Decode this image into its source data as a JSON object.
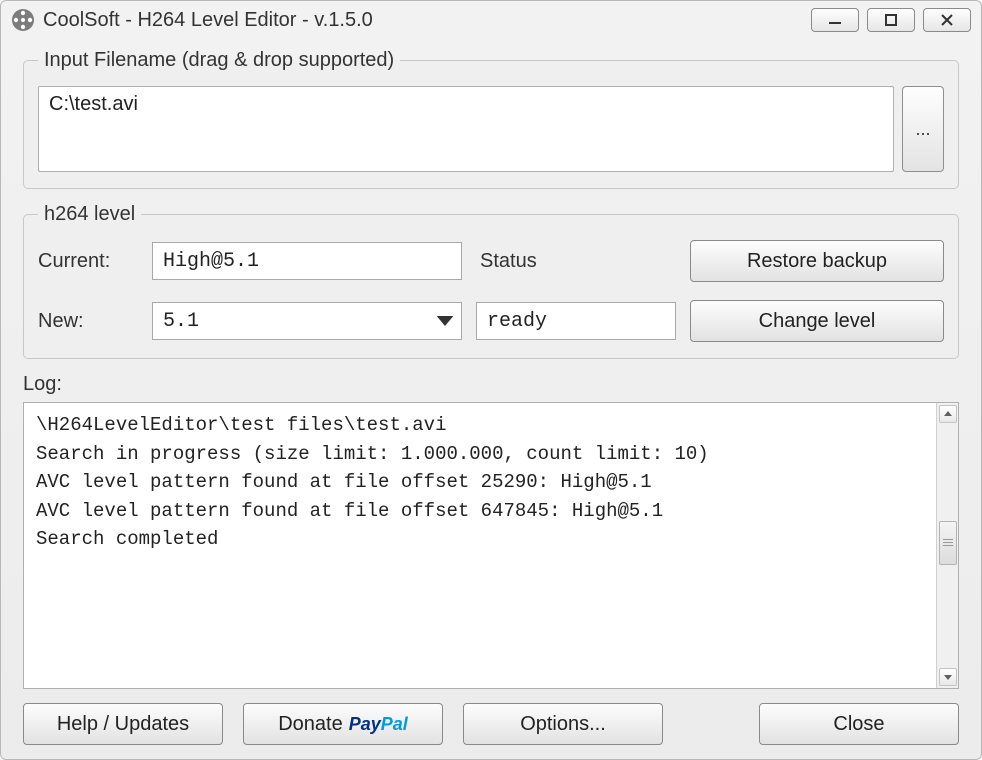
{
  "window": {
    "title": "CoolSoft - H264 Level Editor - v.1.5.0"
  },
  "input_group": {
    "legend": "Input Filename (drag & drop supported)",
    "filename": "C:\\test.avi",
    "browse_label": "..."
  },
  "level_group": {
    "legend": "h264 level",
    "current_label": "Current:",
    "current_value": "High@5.1",
    "new_label": "New:",
    "new_value": "5.1",
    "status_label": "Status",
    "status_value": "ready",
    "restore_label": "Restore backup",
    "change_label": "Change level"
  },
  "log": {
    "label": "Log:",
    "lines": [
      "\\H264LevelEditor\\test files\\test.avi",
      "Search in progress (size limit: 1.000.000, count limit: 10)",
      "AVC level pattern found at file offset 25290: High@5.1",
      "AVC level pattern found at file offset 647845: High@5.1",
      "Search completed"
    ]
  },
  "buttons": {
    "help": "Help / Updates",
    "donate": "Donate",
    "options": "Options...",
    "close": "Close"
  }
}
